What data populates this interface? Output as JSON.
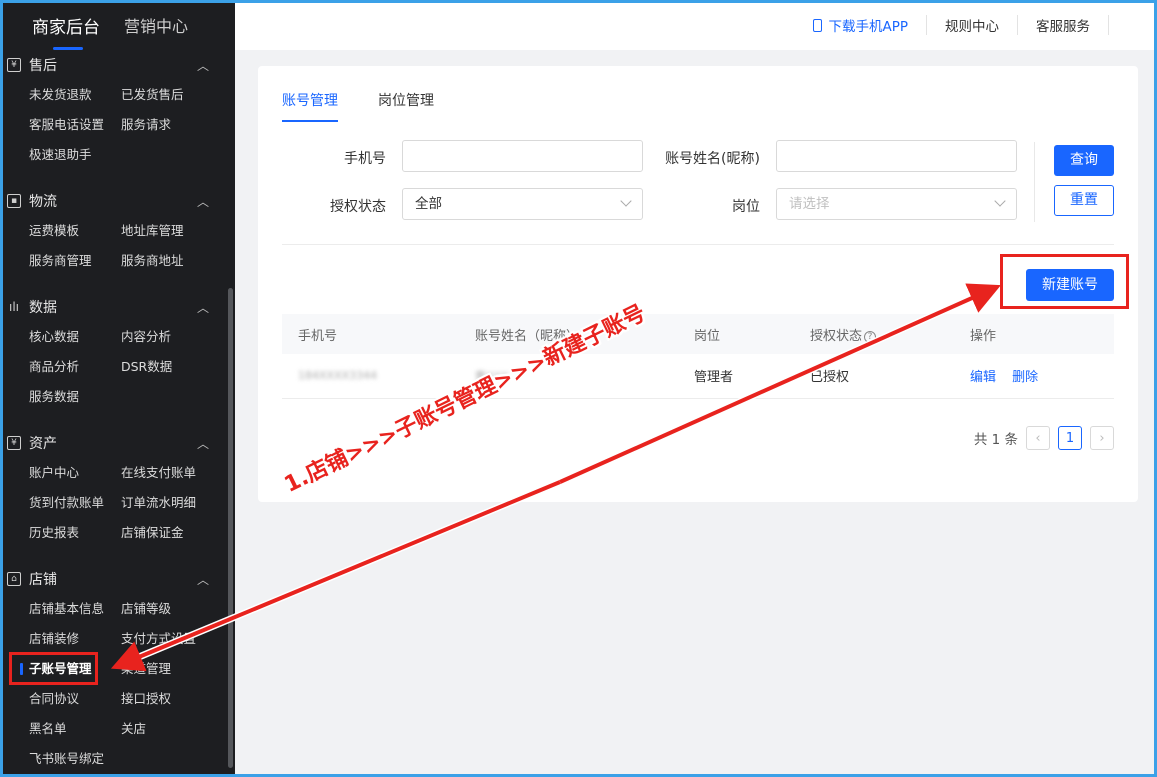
{
  "sidebar": {
    "top_tabs": [
      "商家后台",
      "营销中心"
    ],
    "sections": [
      {
        "title": "售后",
        "icon": "yen-icon",
        "items": [
          "未发货退款",
          "已发货售后",
          "客服电话设置",
          "服务请求",
          "极速退助手"
        ]
      },
      {
        "title": "物流",
        "icon": "truck-icon",
        "items": [
          "运费模板",
          "地址库管理",
          "服务商管理",
          "服务商地址"
        ]
      },
      {
        "title": "数据",
        "icon": "bar-chart-icon",
        "items": [
          "核心数据",
          "内容分析",
          "商品分析",
          "DSR数据",
          "服务数据"
        ]
      },
      {
        "title": "资产",
        "icon": "yen-icon",
        "items": [
          "账户中心",
          "在线支付账单",
          "货到付款账单",
          "订单流水明细",
          "历史报表",
          "店铺保证金"
        ]
      },
      {
        "title": "店铺",
        "icon": "store-icon",
        "items": [
          "店铺基本信息",
          "店铺等级",
          "店铺装修",
          "支付方式设置",
          "子账号管理",
          "渠道管理",
          "合同协议",
          "接口授权",
          "黑名单",
          "关店",
          "飞书账号绑定"
        ]
      }
    ],
    "active_item": "子账号管理"
  },
  "header": {
    "download_app": "下载手机APP",
    "rules": "规则中心",
    "service": "客服服务"
  },
  "tabs": [
    "账号管理",
    "岗位管理"
  ],
  "form": {
    "phone_label": "手机号",
    "phone_value": "",
    "name_label": "账号姓名(昵称)",
    "name_value": "",
    "auth_label": "授权状态",
    "auth_value": "全部",
    "post_label": "岗位",
    "post_placeholder": "请选择",
    "query_button": "查询",
    "reset_button": "重置"
  },
  "new_account_button": "新建账号",
  "table": {
    "headers": [
      "手机号",
      "账号姓名（昵称）",
      "岗位",
      "授权状态",
      "操作"
    ],
    "rows": [
      {
        "phone": "184XXXX3344",
        "name": "曹XXX",
        "post": "管理者",
        "status": "已授权",
        "edit": "编辑",
        "delete": "删除"
      }
    ]
  },
  "pagination": {
    "total": "共 1 条",
    "current": "1"
  },
  "annotation": {
    "text": "1.店铺>>>子账号管理>>>新建子账号",
    "color": "#e8231e"
  }
}
